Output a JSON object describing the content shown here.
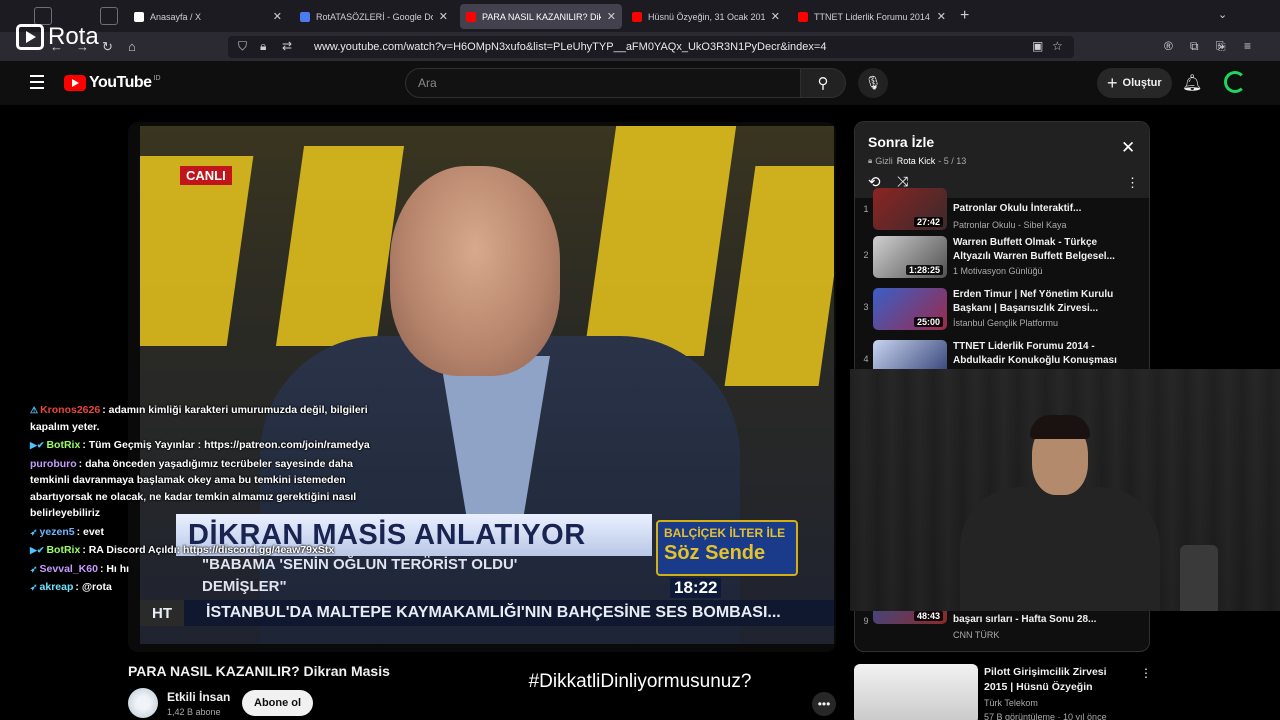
{
  "browser": {
    "tabs": [
      {
        "title": "Anasayfa / X",
        "favicon_color": "#000000"
      },
      {
        "title": "RotATASÖZLERİ - Google Dokü",
        "favicon_color": "#4a7cf0"
      },
      {
        "title": "PARA NASIL KAZANILIR? Dikra",
        "favicon_color": "#ff0000"
      },
      {
        "title": "Hüsnü Özyeğin, 31 Ocak 2017 F",
        "favicon_color": "#ff0000"
      },
      {
        "title": "TTNET Liderlik Forumu 2014 - A",
        "favicon_color": "#ff0000"
      }
    ],
    "url": "www.youtube.com/watch?v=H6OMpN3xufo&list=PLeUhyTYP__aFM0YAQx_UkO3R3N1PyDecr&index=4"
  },
  "overlay_logo": {
    "name": "Rota"
  },
  "youtube": {
    "logo_text": "YouTube",
    "country_code": "ID",
    "search_placeholder": "Ara",
    "create_label": "Oluştur"
  },
  "video": {
    "title": "PARA NASIL KAZANILIR? Dikran Masis",
    "channel": "Etkili İnsan",
    "subscribers": "1,42 B abone",
    "subscribe_label": "Abone ol",
    "hashtag": "#DikkatliDinliyormusunuz?",
    "frame": {
      "live_badge": "CANLI",
      "lower_third": "DİKRAN MASİS ANLATIYOR",
      "quote_line1": "\"BABAMA 'SENİN OĞLUN TERÖRİST OLDU'",
      "quote_line2": "DEMİŞLER\"",
      "show_top": "BALÇİÇEK İLTER İLE",
      "show_bottom": "Söz Sende",
      "clock": "18:22",
      "channel_bug": "HT",
      "ticker": "İSTANBUL'DA MALTEPE KAYMAKAMLIĞI'NIN BAHÇESİNE SES BOMBASI..."
    }
  },
  "chat": [
    {
      "badge": "⚠",
      "user": "Kronos2626",
      "user_color": "#e8463c",
      "text": ": adamın kimliği karakteri umurumuzda değil, bilgileri kapalım yeter."
    },
    {
      "badge": "▶✔",
      "user": "BotRix",
      "user_color": "#9bff66",
      "text": ": Tüm Geçmiş Yayınlar : https://patreon.com/join/ramedya"
    },
    {
      "badge": "",
      "user": "puroburo",
      "user_color": "#c79bff",
      "text": ": daha önceden yaşadığımız tecrübeler sayesinde daha temkinli davranmaya başlamak okey ama bu temkini istemeden abartıyorsak ne olacak, ne kadar temkin almamız gerektiğini nasıl belirleyebiliriz"
    },
    {
      "badge": "➶",
      "user": "yezen5",
      "user_color": "#6fb7ff",
      "text": ": evet"
    },
    {
      "badge": "▶✔",
      "user": "BotRix",
      "user_color": "#9bff66",
      "text": ": RA Discord Açıldı: https://discord.gg/4eaw79xStx"
    },
    {
      "badge": "➶",
      "user": "Sevval_K60",
      "user_color": "#c79bff",
      "text": ": Hı hı"
    },
    {
      "badge": "➶",
      "user": "akreap",
      "user_color": "#6fe3ff",
      "text": ": @rota"
    }
  ],
  "playlist": {
    "title": "Sonra İzle",
    "privacy": "Gizli",
    "owner": "Rota Kick",
    "position": "- 5 / 13",
    "items": [
      {
        "index": "1",
        "title": "Patronlar Okulu İnteraktif...",
        "channel": "Patronlar Okulu - Sibel Kaya",
        "duration": "27:42"
      },
      {
        "index": "2",
        "title": "Warren Buffett Olmak - Türkçe Altyazılı Warren Buffett Belgesel...",
        "channel": "1 Motivasyon Günlüğü",
        "duration": "1:28:25"
      },
      {
        "index": "3",
        "title": "Erden Timur | Nef Yönetim Kurulu Başkanı | Başarısızlık Zirvesi...",
        "channel": "İstanbul Gençlik Platformu",
        "duration": "25:00"
      },
      {
        "index": "4",
        "title": "TTNET Liderlik Forumu 2014 - Abdulkadir Konukoğlu Konuşması",
        "channel": "",
        "duration": ""
      },
      {
        "index": "9",
        "title": "başarı sırları - Hafta Sonu 28...",
        "channel": "CNN TÜRK",
        "duration": "48:43"
      }
    ]
  },
  "recommendation": {
    "title": "Pilott Girişimcilik Zirvesi 2015 | Hüsnü Özyeğin",
    "channel": "Türk Telekom",
    "meta": "57 B görüntüleme · 10 yıl önce"
  }
}
